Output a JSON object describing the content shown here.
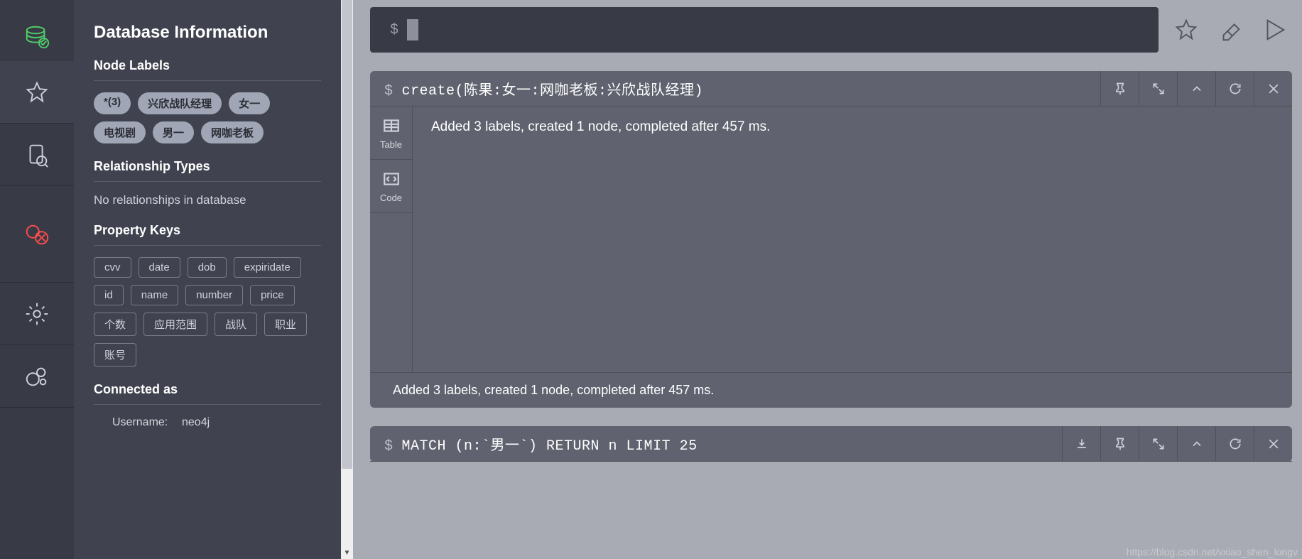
{
  "sidebar": {
    "title": "Database Information",
    "sections": {
      "nodeLabels": "Node Labels",
      "relTypes": "Relationship Types",
      "propKeys": "Property Keys",
      "connectedAs": "Connected as"
    },
    "nodeLabels": [
      "*(3)",
      "兴欣战队经理",
      "女一",
      "电视剧",
      "男一",
      "网咖老板"
    ],
    "relText": "No relationships in database",
    "propKeys": [
      "cvv",
      "date",
      "dob",
      "expiridate",
      "id",
      "name",
      "number",
      "price",
      "个数",
      "应用范围",
      "战队",
      "职业",
      "账号"
    ],
    "conn": {
      "usernameLabel": "Username:",
      "username": "neo4j"
    }
  },
  "editor": {
    "prompt": "$"
  },
  "card1": {
    "query": "create(陈果:女一:网咖老板:兴欣战队经理)",
    "views": {
      "table": "Table",
      "code": "Code"
    },
    "result": "Added 3 labels, created 1 node, completed after 457 ms.",
    "footer": "Added 3 labels, created 1 node, completed after 457 ms."
  },
  "card2": {
    "query": "MATCH (n:`男一`) RETURN n LIMIT 25"
  },
  "watermark": "https://blog.csdn.net/vxiao_shen_longv"
}
